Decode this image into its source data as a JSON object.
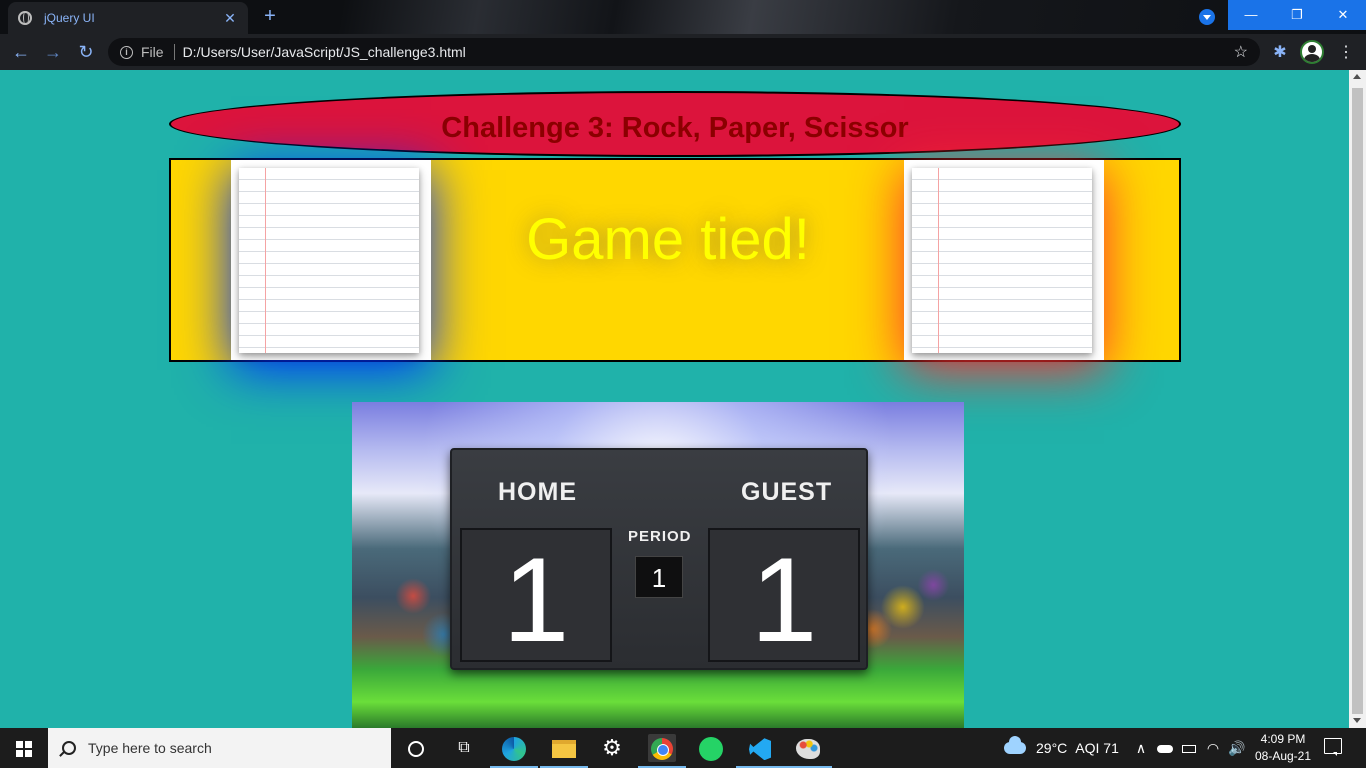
{
  "browser": {
    "tab_title": "jQuery UI",
    "tab_close": "✕",
    "new_tab": "+",
    "back": "←",
    "forward": "→",
    "reload": "↻",
    "info_glyph": "i",
    "file_label": "File",
    "url": "D:/Users/User/JavaScript/JS_challenge3.html",
    "bookmark_glyph": "☆",
    "extensions_glyph": "✱",
    "menu_glyph": "⋮",
    "window_minimize": "—",
    "window_restore": "❐",
    "window_close": "✕",
    "accent_color": "#1a73e8"
  },
  "page": {
    "title": "Challenge 3: Rock, Paper, Scissor",
    "result_message": "Game tied!",
    "human_choice": "paper",
    "bot_choice": "paper",
    "human_glow_color": "#0030ff",
    "bot_glow_color": "#ff3030",
    "background_color": "#20b2aa",
    "box_color": "#ffd700",
    "title_color": "#dc143c"
  },
  "scoreboard": {
    "home_label": "HOME",
    "guest_label": "GUEST",
    "period_label": "PERIOD",
    "home_score": "1",
    "guest_score": "1",
    "period": "1"
  },
  "taskbar": {
    "search_placeholder": "Type here to search",
    "settings_glyph": "⚙",
    "taskview_glyph": "⧉",
    "weather_temp": "29°C",
    "weather_aqi": "AQI 71",
    "tray_chevron": "∧",
    "wifi_glyph": "◠",
    "volume_glyph": "🔊",
    "time": "4:09 PM",
    "date": "08-Aug-21",
    "icons": [
      "cortana-icon",
      "task-view-icon",
      "edge-icon",
      "file-explorer-icon",
      "settings-icon",
      "chrome-icon",
      "whatsapp-icon",
      "vscode-icon",
      "paint-icon"
    ]
  }
}
